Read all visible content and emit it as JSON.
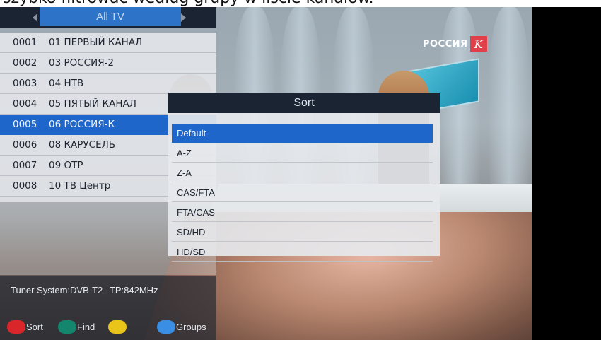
{
  "caption": "szybko filtrować według grupy w liście kanałów.",
  "broadcast_logo": {
    "text": "РОССИЯ",
    "mark": "K",
    "color": "#e0404a"
  },
  "channel_list": {
    "group_title": "All TV",
    "channels": [
      {
        "number": "0001",
        "name": "01 ПЕРВЫЙ КАНАЛ"
      },
      {
        "number": "0002",
        "name": "03 РОССИЯ-2"
      },
      {
        "number": "0003",
        "name": "04 НТВ"
      },
      {
        "number": "0004",
        "name": "05 ПЯТЫЙ КАНАЛ"
      },
      {
        "number": "0005",
        "name": "06 РОССИЯ-К",
        "selected": true
      },
      {
        "number": "0006",
        "name": "08 КАРУСЕЛЬ"
      },
      {
        "number": "0007",
        "name": "09 ОТР"
      },
      {
        "number": "0008",
        "name": "10 ТВ Центр"
      }
    ],
    "selected_color": "#1e66c9"
  },
  "info_bar": {
    "tuner_system": "Tuner System:DVB-T2",
    "tp": "TP:842MHz"
  },
  "color_keys": [
    {
      "color": "red",
      "hex": "#d8262a",
      "label": "Sort"
    },
    {
      "color": "green",
      "hex": "#14866e",
      "label": "Find"
    },
    {
      "color": "yellow",
      "hex": "#e9c51a",
      "label": ""
    },
    {
      "color": "blue",
      "hex": "#3a8fe4",
      "label": "Groups"
    }
  ],
  "sort_dialog": {
    "title": "Sort",
    "options": [
      "Default",
      "A-Z",
      "Z-A",
      "CAS/FTA",
      "FTA/CAS",
      "SD/HD",
      "HD/SD"
    ],
    "selected_option": "Default"
  }
}
